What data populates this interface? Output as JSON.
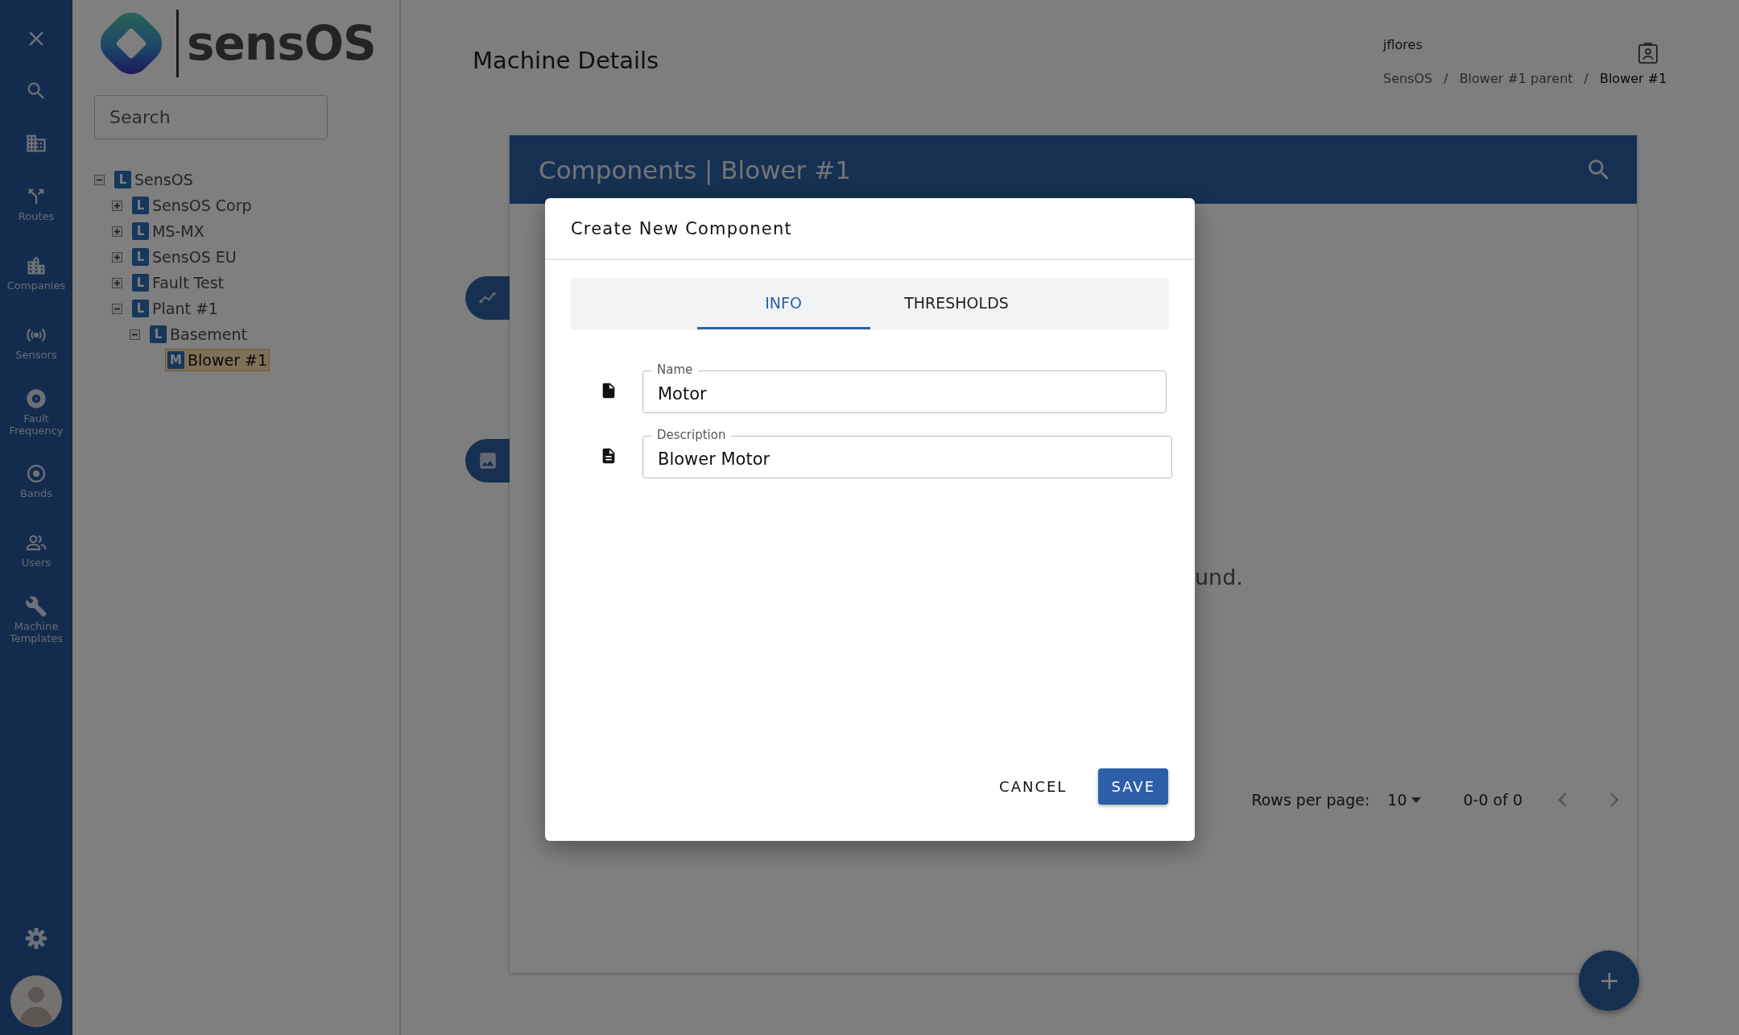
{
  "rail": {
    "items": [
      {
        "kind": "close"
      },
      {
        "kind": "search"
      },
      {
        "kind": "building"
      },
      {
        "kind": "routes",
        "label": "Routes"
      },
      {
        "kind": "companies",
        "label": "Companies"
      },
      {
        "kind": "sensors",
        "label": "Sensors"
      },
      {
        "kind": "fault",
        "label": "Fault Frequency"
      },
      {
        "kind": "bands",
        "label": "Bands"
      },
      {
        "kind": "users",
        "label": "Users"
      },
      {
        "kind": "wrench",
        "label": "Machine Templates"
      }
    ],
    "bottom": [
      {
        "kind": "settings"
      },
      {
        "kind": "avatar"
      }
    ]
  },
  "brand": {
    "name": "sensOS"
  },
  "tree": {
    "search": {
      "placeholder": "Search"
    },
    "nodes": [
      {
        "label": "SensOS",
        "badge": "L",
        "expanded": true,
        "selected": false,
        "children": [
          {
            "label": "SensOS Corp",
            "badge": "L",
            "expanded": false,
            "selected": false
          },
          {
            "label": "MS-MX",
            "badge": "L",
            "expanded": false,
            "selected": false
          },
          {
            "label": "SensOS EU",
            "badge": "L",
            "expanded": false,
            "selected": false
          },
          {
            "label": "Fault Test",
            "badge": "L",
            "expanded": false,
            "selected": false
          },
          {
            "label": "Plant #1",
            "badge": "L",
            "expanded": true,
            "selected": false,
            "children": [
              {
                "label": "Basement",
                "badge": "L",
                "expanded": true,
                "selected": false,
                "children": [
                  {
                    "label": "Blower #1",
                    "badge": "M",
                    "selected": true
                  }
                ]
              }
            ]
          }
        ]
      }
    ]
  },
  "header": {
    "title": "Machine Details",
    "user": "jflores",
    "breadcrumbs": [
      {
        "kind": "crumb",
        "label": "SensOS",
        "current": false
      },
      {
        "kind": "separator",
        "label": "/"
      },
      {
        "kind": "crumb",
        "label": "Blower #1 parent",
        "current": false
      },
      {
        "kind": "separator",
        "label": "/"
      },
      {
        "kind": "crumb",
        "label": "Blower #1",
        "current": true
      }
    ]
  },
  "card": {
    "title": "Components | Blower #1",
    "side_tabs": [
      {
        "kind": "chart"
      },
      {
        "kind": "image"
      }
    ],
    "empty_text": "und.",
    "pagination": {
      "rows_label": "Rows per page:",
      "rows_value": "10",
      "range": "0-0 of 0"
    }
  },
  "modal": {
    "title": "Create New Component",
    "tabs": [
      {
        "label": "INFO",
        "selected": true
      },
      {
        "label": "THRESHOLDS",
        "selected": false
      }
    ],
    "fields": [
      {
        "kind": "file",
        "label": "Name",
        "value": "Motor"
      },
      {
        "kind": "description",
        "label": "Description",
        "value": "Blower Motor"
      }
    ],
    "buttons": [
      {
        "kind": "text",
        "label": "CANCEL"
      },
      {
        "kind": "primary",
        "label": "SAVE"
      }
    ]
  }
}
